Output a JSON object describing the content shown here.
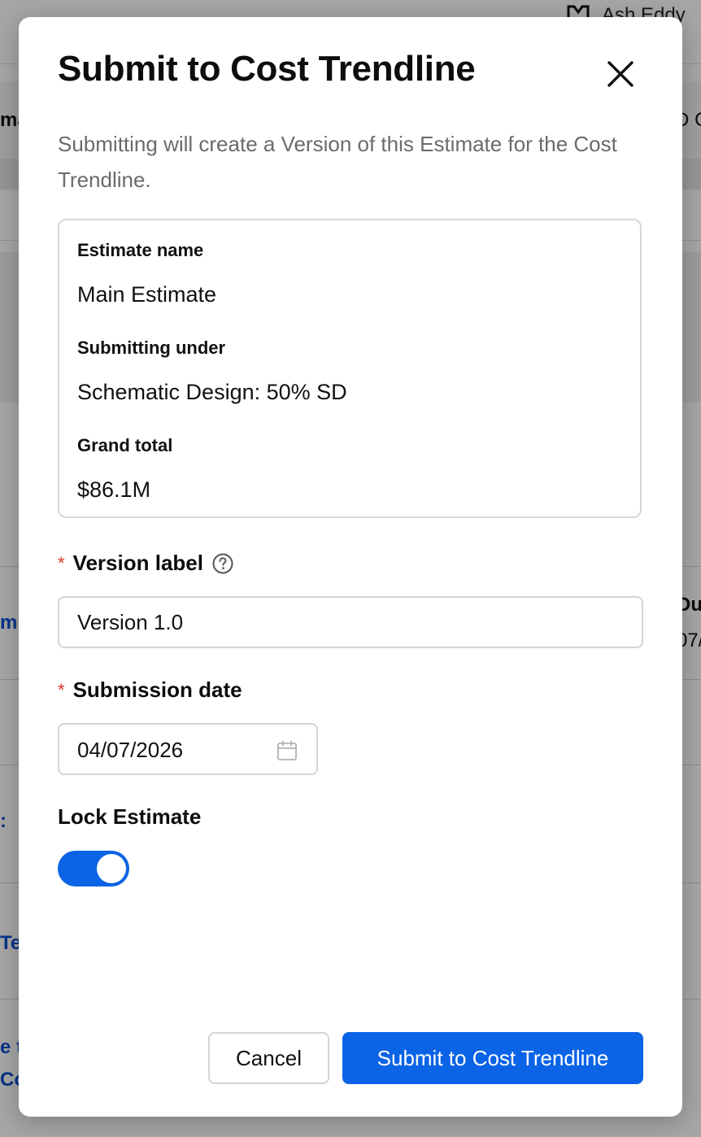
{
  "background": {
    "user_name": "Ash Eddy",
    "fragments": [
      "ma",
      "D C",
      "m",
      "Du",
      "07/",
      ":",
      "Te",
      "e t",
      "Co"
    ]
  },
  "modal": {
    "title": "Submit to Cost Trendline",
    "subtitle": "Submitting will create a Version of this Estimate for the Cost Trendline.",
    "close_icon": "close-icon"
  },
  "summary": {
    "estimate_name_label": "Estimate name",
    "estimate_name_value": "Main Estimate",
    "submitting_under_label": "Submitting under",
    "submitting_under_value": "Schematic Design: 50% SD",
    "grand_total_label": "Grand total",
    "grand_total_value": "$86.1M"
  },
  "form": {
    "required_mark": "*",
    "version_label": "Version label",
    "version_value": "Version 1.0",
    "help_icon": "question-circle-icon",
    "submission_date_label": "Submission date",
    "submission_date_value": "04/07/2026",
    "calendar_icon": "calendar-icon",
    "lock_label": "Lock Estimate",
    "lock_enabled": true
  },
  "footer": {
    "cancel_label": "Cancel",
    "submit_label": "Submit to Cost Trendline"
  },
  "colors": {
    "primary": "#0b63e5",
    "required": "#e0362c",
    "subtitle_text": "#6b6b6b",
    "border": "#d4d4d8"
  }
}
